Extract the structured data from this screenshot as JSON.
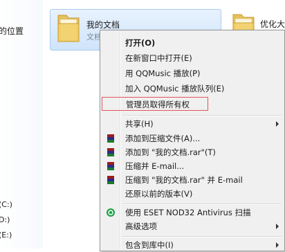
{
  "nav": {
    "location_label": "的位置",
    "drive_c": "(C:)",
    "drive_d": "D:)",
    "drive_e": "(E:)"
  },
  "files": [
    {
      "name": "我的文档",
      "subtitle": "文档"
    },
    {
      "name": "优化大"
    }
  ],
  "menu": {
    "open": "打开(O)",
    "open_new_window": "在新窗口中打开(E)",
    "play_qqmusic": "用 QQMusic 播放(P)",
    "add_qqmusic_queue": "加入 QQMusic 播放队列(E)",
    "take_ownership": "管理员取得所有权",
    "share": "共享(H)",
    "add_to_archive": "添加到压缩文件(A)...",
    "add_to_rar": "添加到 \"我的文档.rar\"(T)",
    "compress_email": "压缩并 E-mail...",
    "compress_rar_email": "压缩到 \"我的文档.rar\" 并 E-mail",
    "restore_previous": "还原以前的版本(V)",
    "eset_scan": "使用 ESET NOD32 Antivirus 扫描",
    "advanced": "高级选项",
    "include_library": "包含到库中(I)"
  },
  "colors": {
    "menu_bg": "#f0f0f0",
    "highlight_border": "#e1565a",
    "tile_bg": "#d9eafc",
    "eset_green": "#1fa34a",
    "rar_red": "#9c1d1d"
  },
  "icons": {
    "rar": "winrar-books-icon",
    "eset": "eset-icon",
    "submenu": "chevron-right-icon"
  }
}
